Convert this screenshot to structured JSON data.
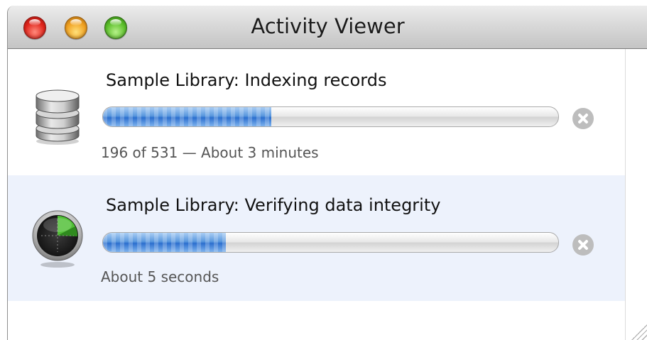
{
  "window": {
    "title": "Activity Viewer"
  },
  "activities": [
    {
      "name": "Sample Library: Indexing records",
      "status": "196 of 531 — About 3 minutes",
      "progress": 0.37,
      "icon": "database-icon"
    },
    {
      "name": "Sample Library: Verifying data integrity",
      "status": "About 5 seconds",
      "progress": 0.27,
      "icon": "radar-gauge-icon"
    }
  ],
  "colors": {
    "progress_fill": "#3a7fd9",
    "selected_row": "#edf2fc",
    "close_light": "#e0241b",
    "minimize_light": "#f0a020",
    "zoom_light": "#5cbf2a"
  }
}
